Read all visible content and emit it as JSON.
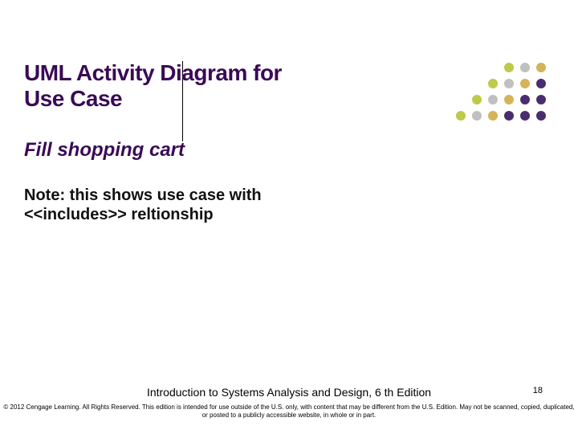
{
  "title": "UML Activity Diagram for Use Case",
  "subtitle": "Fill shopping cart",
  "note": "Note: this shows use case with <<includes>> reltionship",
  "footer": {
    "book": "Introduction to Systems Analysis and Design, 6 th Edition",
    "copyright": "© 2012 Cengage Learning. All Rights Reserved. This edition is intended for use outside of the U.S. only, with content that may be different from the U.S. Edition. May not be scanned, copied, duplicated, or posted to a publicly accessible website, in whole or in part."
  },
  "page_number": "18"
}
